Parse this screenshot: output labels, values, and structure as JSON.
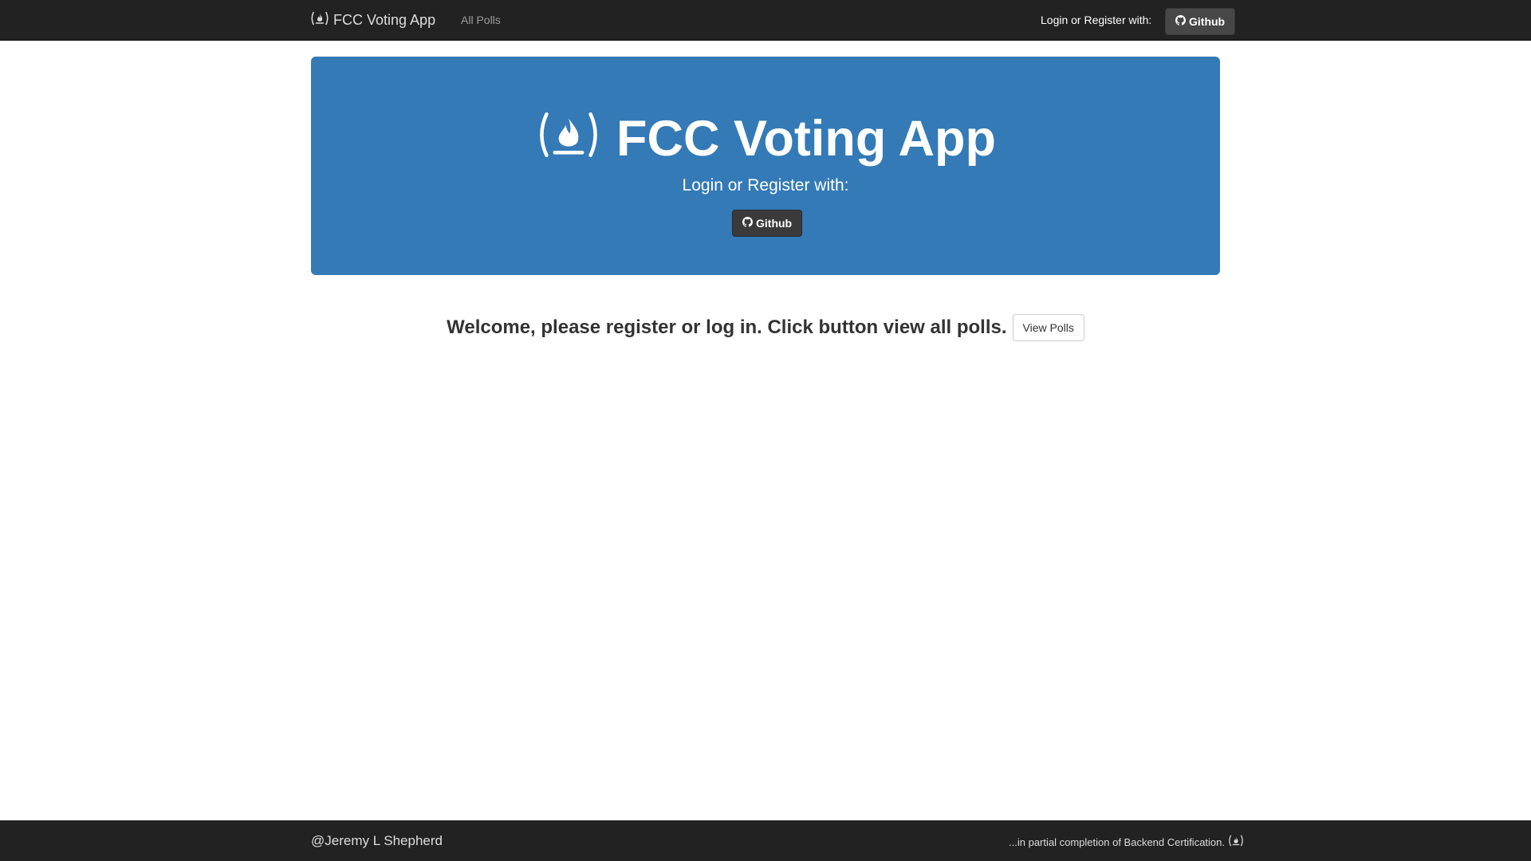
{
  "navbar": {
    "brand_icon": "freecodecamp-flame-icon",
    "brand_label": "FCC Voting App",
    "links": [
      {
        "label": "All Polls"
      }
    ],
    "auth_text": "Login or Register with:",
    "github_button": {
      "icon": "github-icon",
      "label": "Github"
    }
  },
  "hero": {
    "icon": "freecodecamp-flame-icon",
    "title": "FCC Voting App",
    "subtitle": "Login or Register with:",
    "github_button": {
      "icon": "github-icon",
      "label": "Github"
    },
    "background_color": "#337ab7"
  },
  "main": {
    "welcome_text": "Welcome, please register or log in. Click button view all polls.",
    "view_polls_button": "View Polls"
  },
  "footer": {
    "author": "@Jeremy L Shepherd",
    "note": "...in partial completion of Backend Certification.",
    "note_icon": "freecodecamp-flame-icon"
  },
  "colors": {
    "navbar_bg": "#222222",
    "accent": "#337ab7",
    "button_dark": "#3a3a3a"
  }
}
